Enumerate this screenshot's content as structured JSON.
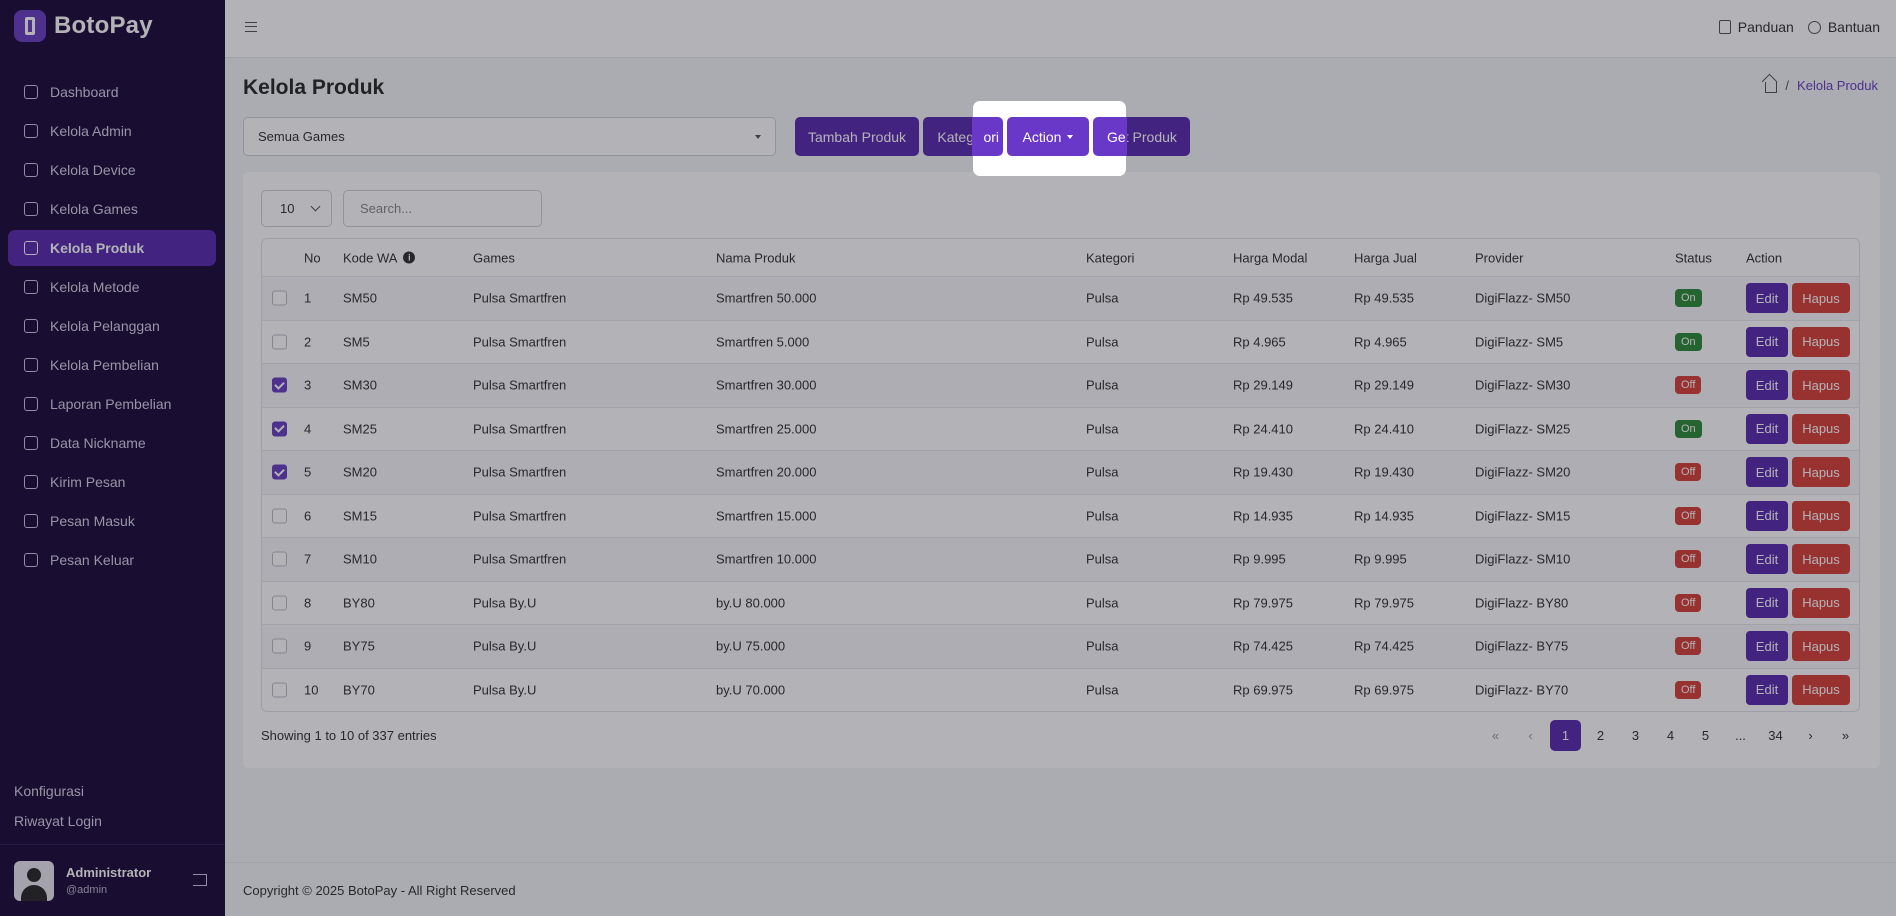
{
  "app": {
    "brand": "BotoPay"
  },
  "sidebar": {
    "items": [
      {
        "label": "Dashboard",
        "icon": "home-icon"
      },
      {
        "label": "Kelola Admin",
        "icon": "user-icon"
      },
      {
        "label": "Kelola Device",
        "icon": "device-icon"
      },
      {
        "label": "Kelola Games",
        "icon": "gamepad-icon"
      },
      {
        "label": "Kelola Produk",
        "icon": "box-icon",
        "active": true
      },
      {
        "label": "Kelola Metode",
        "icon": "card-icon"
      },
      {
        "label": "Kelola Pelanggan",
        "icon": "users-icon"
      },
      {
        "label": "Kelola Pembelian",
        "icon": "cart-icon"
      },
      {
        "label": "Laporan Pembelian",
        "icon": "report-icon"
      },
      {
        "label": "Data Nickname",
        "icon": "file-icon"
      },
      {
        "label": "Kirim Pesan",
        "icon": "send-icon"
      },
      {
        "label": "Pesan Masuk",
        "icon": "message-icon"
      },
      {
        "label": "Pesan Keluar",
        "icon": "message-out-icon"
      }
    ],
    "bottom_links": [
      "Konfigurasi",
      "Riwayat Login"
    ],
    "user": {
      "name": "Administrator",
      "handle": "@admin"
    }
  },
  "header": {
    "panduan": "Panduan",
    "bantuan": "Bantuan"
  },
  "page": {
    "title": "Kelola Produk",
    "breadcrumb": "Kelola Produk",
    "game_select": "Semua Games",
    "buttons": {
      "tambah": "Tambah Produk",
      "kategori": "Kategori",
      "action": "Action",
      "get": "Get Produk"
    },
    "length_select": "10",
    "search_placeholder": "Search..."
  },
  "table": {
    "headers": {
      "no": "No",
      "kode": "Kode WA",
      "games": "Games",
      "nama": "Nama Produk",
      "kategori": "Kategori",
      "modal": "Harga Modal",
      "jual": "Harga Jual",
      "provider": "Provider",
      "status": "Status",
      "action": "Action"
    },
    "edit_label": "Edit",
    "hapus_label": "Hapus",
    "rows": [
      {
        "checked": false,
        "no": "1",
        "kode": "SM50",
        "games": "Pulsa Smartfren",
        "nama": "Smartfren 50.000",
        "kategori": "Pulsa",
        "modal": "Rp 49.535",
        "jual": "Rp 49.535",
        "provider": "DigiFlazz- SM50",
        "status": "On"
      },
      {
        "checked": false,
        "no": "2",
        "kode": "SM5",
        "games": "Pulsa Smartfren",
        "nama": "Smartfren 5.000",
        "kategori": "Pulsa",
        "modal": "Rp 4.965",
        "jual": "Rp 4.965",
        "provider": "DigiFlazz- SM5",
        "status": "On"
      },
      {
        "checked": true,
        "no": "3",
        "kode": "SM30",
        "games": "Pulsa Smartfren",
        "nama": "Smartfren 30.000",
        "kategori": "Pulsa",
        "modal": "Rp 29.149",
        "jual": "Rp 29.149",
        "provider": "DigiFlazz- SM30",
        "status": "Off"
      },
      {
        "checked": true,
        "no": "4",
        "kode": "SM25",
        "games": "Pulsa Smartfren",
        "nama": "Smartfren 25.000",
        "kategori": "Pulsa",
        "modal": "Rp 24.410",
        "jual": "Rp 24.410",
        "provider": "DigiFlazz- SM25",
        "status": "On"
      },
      {
        "checked": true,
        "no": "5",
        "kode": "SM20",
        "games": "Pulsa Smartfren",
        "nama": "Smartfren 20.000",
        "kategori": "Pulsa",
        "modal": "Rp 19.430",
        "jual": "Rp 19.430",
        "provider": "DigiFlazz- SM20",
        "status": "Off"
      },
      {
        "checked": false,
        "no": "6",
        "kode": "SM15",
        "games": "Pulsa Smartfren",
        "nama": "Smartfren 15.000",
        "kategori": "Pulsa",
        "modal": "Rp 14.935",
        "jual": "Rp 14.935",
        "provider": "DigiFlazz- SM15",
        "status": "Off"
      },
      {
        "checked": false,
        "no": "7",
        "kode": "SM10",
        "games": "Pulsa Smartfren",
        "nama": "Smartfren 10.000",
        "kategori": "Pulsa",
        "modal": "Rp 9.995",
        "jual": "Rp 9.995",
        "provider": "DigiFlazz- SM10",
        "status": "Off"
      },
      {
        "checked": false,
        "no": "8",
        "kode": "BY80",
        "games": "Pulsa By.U",
        "nama": "by.U 80.000",
        "kategori": "Pulsa",
        "modal": "Rp 79.975",
        "jual": "Rp 79.975",
        "provider": "DigiFlazz- BY80",
        "status": "Off"
      },
      {
        "checked": false,
        "no": "9",
        "kode": "BY75",
        "games": "Pulsa By.U",
        "nama": "by.U 75.000",
        "kategori": "Pulsa",
        "modal": "Rp 74.425",
        "jual": "Rp 74.425",
        "provider": "DigiFlazz- BY75",
        "status": "Off"
      },
      {
        "checked": false,
        "no": "10",
        "kode": "BY70",
        "games": "Pulsa By.U",
        "nama": "by.U 70.000",
        "kategori": "Pulsa",
        "modal": "Rp 69.975",
        "jual": "Rp 69.975",
        "provider": "DigiFlazz- BY70",
        "status": "Off"
      }
    ],
    "showing": "Showing 1 to 10 of 337 entries"
  },
  "pagination": {
    "first": "«",
    "prev": "‹",
    "pages": [
      "1",
      "2",
      "3",
      "4",
      "5",
      "...",
      "34"
    ],
    "active": "1",
    "next": "›",
    "last": "»"
  },
  "footer": {
    "copyright": "Copyright © 2025 BotoPay - All Right Reserved"
  },
  "colors": {
    "primary": "#5b2cae",
    "sidebar": "#1c0b3a",
    "danger": "#d8423a",
    "success": "#2f8b3a"
  }
}
